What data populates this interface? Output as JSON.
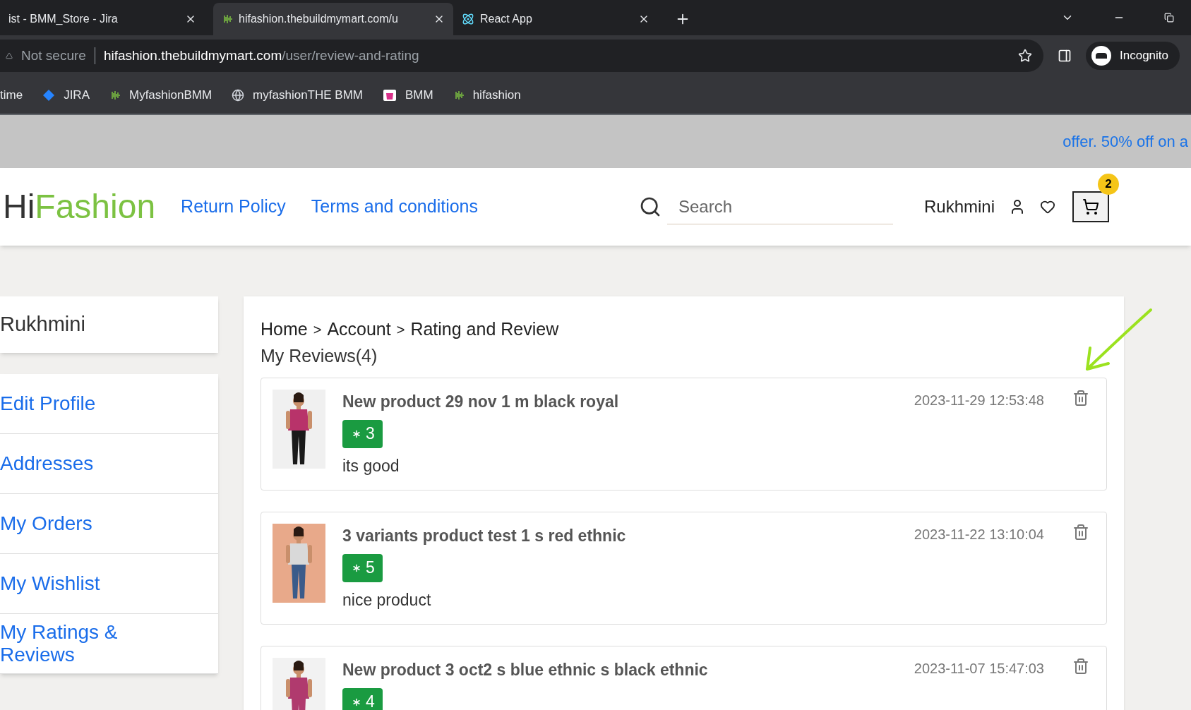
{
  "browser": {
    "tabs": [
      {
        "title": "ist - BMM_Store - Jira",
        "selected": false
      },
      {
        "title": "hifashion.thebuildmymart.com/u",
        "selected": true
      },
      {
        "title": "React App",
        "selected": false
      }
    ],
    "security": "Not secure",
    "url_host": "hifashion.thebuildmymart.com",
    "url_path": "/user/review-and-rating",
    "profile": "Incognito",
    "bookmarks": [
      "time",
      "JIRA",
      "MyfashionBMM",
      "myfashionTHE BMM",
      "BMM",
      "hifashion"
    ]
  },
  "promo": "offer. 50% off on a",
  "header": {
    "logo_dark": "Hi",
    "logo_light": "Fashion",
    "links": [
      "Return Policy",
      "Terms and conditions"
    ],
    "search_placeholder": "Search",
    "user": "Rukhmini",
    "cart_count": "2"
  },
  "sidebar": {
    "name": "Rukhmini",
    "items": [
      "Edit Profile",
      "Addresses",
      "My Orders",
      "My Wishlist",
      "My Ratings & Reviews"
    ]
  },
  "breadcrumb": [
    "Home",
    "Account",
    "Rating and Review"
  ],
  "breadcrumb_separator": ">",
  "heading": "My Reviews(4)",
  "reviews": [
    {
      "product": "New product 29 nov 1 m black royal",
      "date": "2023-11-29 12:53:48",
      "rating": "3",
      "comment": "its good"
    },
    {
      "product": "3 variants product test 1 s red ethnic",
      "date": "2023-11-22 13:10:04",
      "rating": "5",
      "comment": "nice product"
    },
    {
      "product": "New product 3 oct2 s blue ethnic s black ethnic",
      "date": "2023-11-07 15:47:03",
      "rating": "4"
    }
  ]
}
